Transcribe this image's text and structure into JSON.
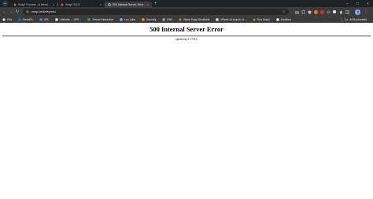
{
  "tabs": [
    {
      "title": "Snap! Forums - A friendly plac...",
      "favicon": "snap-icon",
      "active": false
    },
    {
      "title": "Snap! 9.0.5",
      "favicon": "snap-icon",
      "active": false
    },
    {
      "title": "500 Internal Server Error",
      "favicon": "globe-icon",
      "active": true
    }
  ],
  "address_bar": {
    "url": "snap.berkeley.edu"
  },
  "bookmarks": [
    {
      "label": "Gist",
      "icon": "gist-icon"
    },
    {
      "label": "NewsRx",
      "icon": "newsrx-icon"
    },
    {
      "label": "URL",
      "icon": "url-icon"
    },
    {
      "label": "Website — APE...",
      "icon": "website-icon"
    },
    {
      "label": "Tenner Interactive",
      "icon": "tenner-icon"
    },
    {
      "label": "Lox Labs",
      "icon": "loxlabs-icon"
    },
    {
      "label": "Security",
      "icon": "security-icon"
    },
    {
      "label": "ENC",
      "icon": "enc-icon"
    },
    {
      "label": "Make Snap Scrollable",
      "icon": "snap-icon"
    },
    {
      "label": "What's Ui search of...",
      "icon": "page-icon"
    },
    {
      "label": "Run Snap!",
      "icon": "snap-icon"
    },
    {
      "label": "Sandbox",
      "icon": "sandbox-icon"
    }
  ],
  "all_bookmarks_label": "All Bookmarks",
  "page": {
    "title": "500 Internal Server Error",
    "server": "openresty/1.17.8.2"
  },
  "colors": {
    "chrome_dark": "#202124",
    "toolbar": "#3c3c3c",
    "omnibox": "#282828",
    "page_bg": "#ffffff"
  }
}
